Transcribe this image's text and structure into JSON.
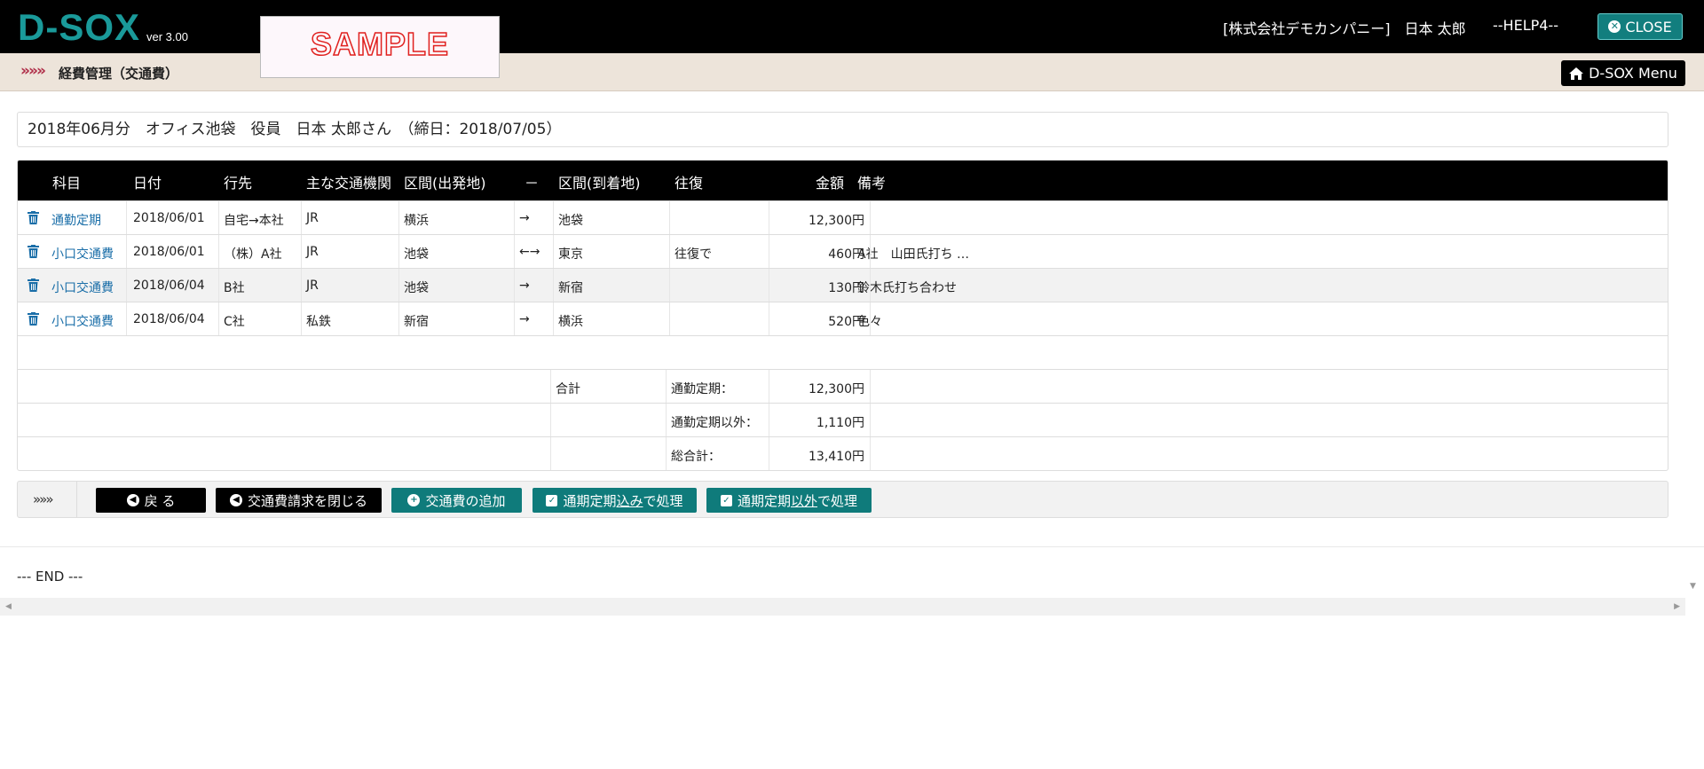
{
  "header": {
    "logo": "D-SOX",
    "version": "ver 3.00",
    "sample_label": "SAMPLE",
    "user_info": "[株式会社デモカンパニー]　日本 太郎",
    "help": "--HELP4--",
    "close_label": "CLOSE"
  },
  "subheader": {
    "arrows": "»»»",
    "title": "経費管理（交通費）",
    "menu_label": "D-SOX Menu"
  },
  "info": {
    "text": "2018年06月分　オフィス池袋　役員　日本 太郎さん　（締日：2018/07/05）"
  },
  "table": {
    "headers": {
      "subject": "科目",
      "date": "日付",
      "destination": "行先",
      "transport": "主な交通機関",
      "from": "区間(出発地)",
      "dash": "－",
      "to": "区間(到着地)",
      "roundtrip": "往復",
      "amount": "金額",
      "note": "備考"
    },
    "rows": [
      {
        "subject": "通勤定期",
        "date": "2018/06/01",
        "destination": "自宅→本社",
        "transport": "JR",
        "from": "横浜",
        "dir": "→",
        "to": "池袋",
        "roundtrip": "",
        "amount": "12,300円",
        "note": ""
      },
      {
        "subject": "小口交通費",
        "date": "2018/06/01",
        "destination": "（株）A社",
        "transport": "JR",
        "from": "池袋",
        "dir": "←→",
        "to": "東京",
        "roundtrip": "往復で",
        "amount": "460円",
        "note": "A社　山田氏打ち …"
      },
      {
        "subject": "小口交通費",
        "date": "2018/06/04",
        "destination": "B社",
        "transport": "JR",
        "from": "池袋",
        "dir": "→",
        "to": "新宿",
        "roundtrip": "",
        "amount": "130円",
        "note": "鈴木氏打ち合わせ"
      },
      {
        "subject": "小口交通費",
        "date": "2018/06/04",
        "destination": "C社",
        "transport": "私鉄",
        "from": "新宿",
        "dir": "→",
        "to": "横浜",
        "roundtrip": "",
        "amount": "520円",
        "note": "色々"
      }
    ],
    "totals": {
      "label": "合計",
      "commute_label": "通勤定期：",
      "commute_value": "12,300円",
      "other_label": "通勤定期以外：",
      "other_value": "1,110円",
      "grand_label": "総合計：",
      "grand_value": "13,410円"
    }
  },
  "actions": {
    "arrows": "»»»",
    "back": "戻 る",
    "close_request": "交通費請求を閉じる",
    "add": "交通費の追加",
    "proc_in_a": "通期定期",
    "proc_in_b": "込み",
    "proc_in_c": "で処理",
    "proc_ex_a": "通期定期",
    "proc_ex_b": "以外",
    "proc_ex_c": "で処理"
  },
  "footer": {
    "end": "--- END ---"
  },
  "colors": {
    "logo": "#1a9a9a",
    "teal_button": "#0f7b7b",
    "link": "#1a6ea8",
    "subbar_bg": "#ede4da"
  }
}
